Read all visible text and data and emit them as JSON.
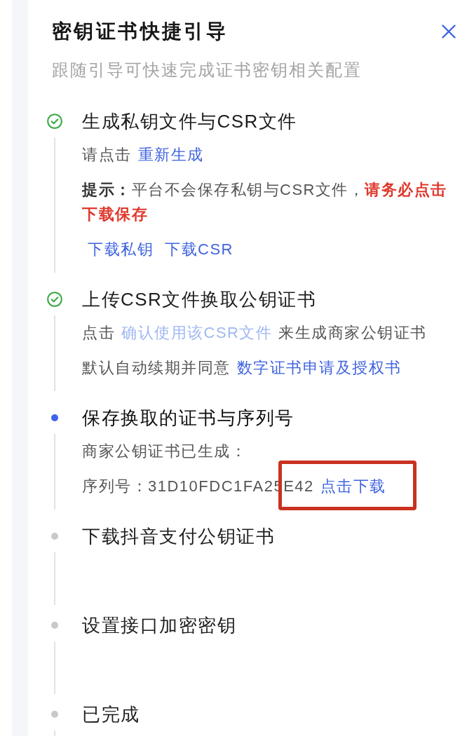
{
  "drawer": {
    "title": "密钥证书快捷引导",
    "subtitle": "跟随引导可快速完成证书密钥相关配置"
  },
  "steps": [
    {
      "title": "生成私钥文件与CSR文件",
      "completed": true,
      "active": false,
      "body": [
        {
          "kind": "paragraph",
          "parts": [
            {
              "kind": "text",
              "text": "请点击"
            },
            {
              "kind": "link",
              "text": "重新生成",
              "disabled": false,
              "highlighted": false
            }
          ]
        },
        {
          "kind": "paragraph",
          "parts": [
            {
              "kind": "strong",
              "text": "提示："
            },
            {
              "kind": "text",
              "text": "平台不会保存私钥与CSR文件，"
            },
            {
              "kind": "warning",
              "text": "请务必点击下载保存"
            }
          ]
        },
        {
          "kind": "actions",
          "parts": [
            {
              "kind": "link",
              "text": "下载私钥",
              "disabled": false,
              "highlighted": false
            },
            {
              "kind": "link",
              "text": "下载CSR",
              "disabled": false,
              "highlighted": false
            }
          ]
        }
      ]
    },
    {
      "title": "上传CSR文件换取公钥证书",
      "completed": true,
      "active": false,
      "body": [
        {
          "kind": "paragraph",
          "parts": [
            {
              "kind": "text",
              "text": "点击"
            },
            {
              "kind": "link",
              "text": "确认使用该CSR文件",
              "disabled": true,
              "highlighted": false
            },
            {
              "kind": "text",
              "text": "来生成商家公钥证书"
            }
          ]
        },
        {
          "kind": "paragraph",
          "parts": [
            {
              "kind": "text",
              "text": "默认自动续期并同意"
            },
            {
              "kind": "link",
              "text": "数字证书申请及授权书",
              "disabled": false,
              "highlighted": false
            }
          ]
        }
      ]
    },
    {
      "title": "保存换取的证书与序列号",
      "completed": false,
      "active": true,
      "body": [
        {
          "kind": "paragraph",
          "parts": [
            {
              "kind": "text",
              "text": "商家公钥证书已生成："
            }
          ]
        },
        {
          "kind": "paragraph",
          "parts": [
            {
              "kind": "text",
              "text": "序列号：31D10FDC1FA25E42"
            },
            {
              "kind": "link",
              "text": "点击下载",
              "disabled": false,
              "highlighted": true
            }
          ]
        }
      ]
    },
    {
      "title": "下载抖音支付公钥证书",
      "completed": false,
      "active": false
    },
    {
      "title": "设置接口加密密钥",
      "completed": false,
      "active": false
    },
    {
      "title": "已完成",
      "completed": false,
      "active": false
    }
  ]
}
